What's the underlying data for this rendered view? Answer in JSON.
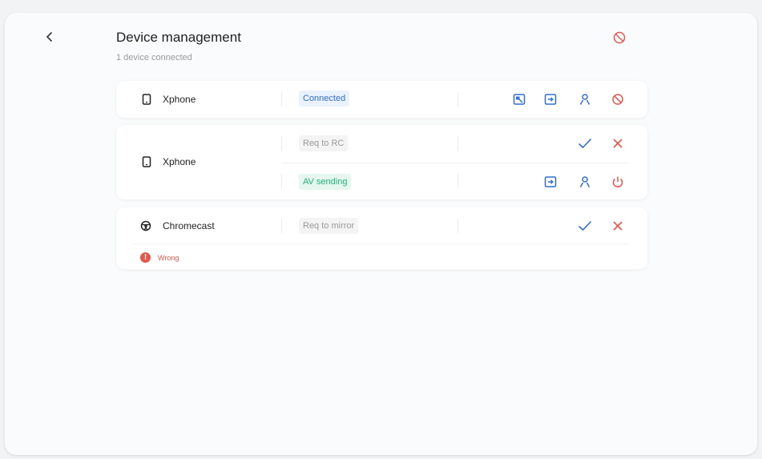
{
  "header": {
    "title": "Device management",
    "subtitle": "1 device connected",
    "back_icon": "chevron-left-icon",
    "disconnect_all_icon": "block-icon"
  },
  "colors": {
    "accent_blue": "#2f6fd6",
    "danger_red": "#e4574c",
    "success_green": "#1fb57d"
  },
  "devices": [
    {
      "name": "Xphone",
      "icon": "phone-icon",
      "status": "Connected",
      "actions": [
        "screen-share-icon",
        "file-transfer-icon",
        "user-icon",
        "block-icon"
      ]
    },
    {
      "name": "Xphone",
      "icon": "phone-icon",
      "requests": [
        {
          "status": "Req to RC",
          "actions": [
            "check-icon",
            "close-icon"
          ]
        },
        {
          "status": "AV sending",
          "actions": [
            "file-transfer-icon",
            "user-icon",
            "power-icon"
          ]
        }
      ]
    },
    {
      "name": "Chromecast",
      "icon": "chromecast-icon",
      "status": "Req to mirror",
      "actions": [
        "check-icon",
        "close-icon"
      ],
      "error": "Wrong"
    }
  ]
}
